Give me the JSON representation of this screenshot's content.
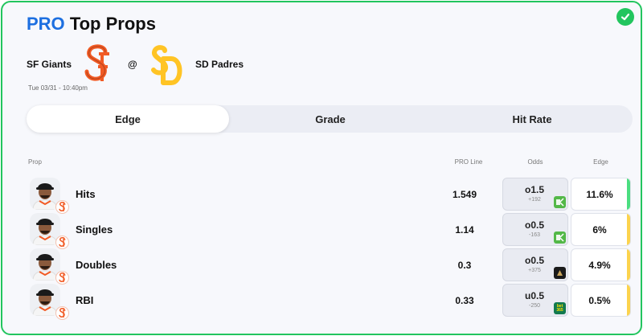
{
  "header": {
    "pro": "PRO",
    "title": "Top Props"
  },
  "matchup": {
    "away_team": "SF Giants",
    "at": "@",
    "home_team": "SD Padres",
    "datetime": "Tue 03/31 - 10:40pm"
  },
  "tabs": [
    {
      "label": "Edge",
      "active": true
    },
    {
      "label": "Grade",
      "active": false
    },
    {
      "label": "Hit Rate",
      "active": false
    }
  ],
  "columns": {
    "prop": "Prop",
    "pro_line": "PRO Line",
    "odds": "Odds",
    "edge": "Edge"
  },
  "rows": [
    {
      "prop": "Hits",
      "pro_line": "1.549",
      "odds_line": "o1.5",
      "odds_price": "+192",
      "book": "draftkings-icon",
      "edge": "11.6%",
      "edge_color": "#4ade80"
    },
    {
      "prop": "Singles",
      "pro_line": "1.14",
      "odds_line": "o0.5",
      "odds_price": "-163",
      "book": "draftkings-icon",
      "edge": "6%",
      "edge_color": "#fcd34d"
    },
    {
      "prop": "Doubles",
      "pro_line": "0.3",
      "odds_line": "o0.5",
      "odds_price": "+375",
      "book": "betmgm-icon",
      "edge": "4.9%",
      "edge_color": "#fcd34d"
    },
    {
      "prop": "RBI",
      "pro_line": "0.33",
      "odds_line": "u0.5",
      "odds_price": "-250",
      "book": "bet365-icon",
      "edge": "0.5%",
      "edge_color": "#fcd34d"
    }
  ],
  "book_labels": {
    "bet365": "bet 365"
  },
  "colors": {
    "accent": "#1d6fe0",
    "border": "#22c55e",
    "giants_orange": "#f15a24",
    "padres_gold": "#ffc425"
  }
}
